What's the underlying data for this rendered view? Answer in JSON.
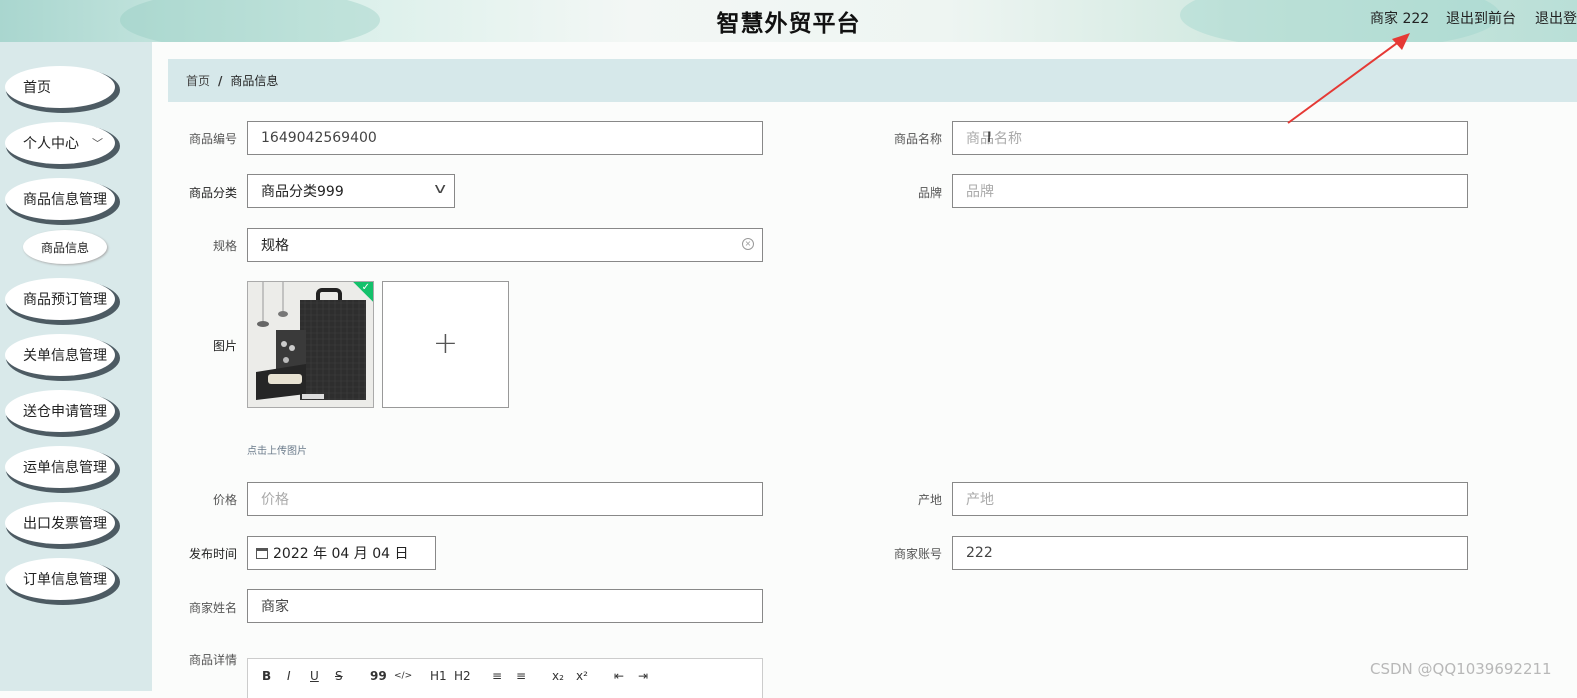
{
  "header": {
    "title": "智慧外贸平台",
    "user": "商家 222",
    "links": [
      "退出到前台",
      "退出登录"
    ]
  },
  "sidebar": {
    "items": [
      {
        "label": "首页"
      },
      {
        "label": "个人中心",
        "has_arrow": true
      },
      {
        "label": "商品信息管理"
      },
      {
        "label": "商品预订管理"
      },
      {
        "label": "关单信息管理"
      },
      {
        "label": "送仓申请管理"
      },
      {
        "label": "运单信息管理"
      },
      {
        "label": "出口发票管理"
      },
      {
        "label": "订单信息管理"
      }
    ],
    "sub_item": "商品信息"
  },
  "breadcrumb": {
    "home": "首页",
    "separator": "/",
    "current": "商品信息"
  },
  "form": {
    "product_no": {
      "label": "商品编号",
      "value": "1649042569400"
    },
    "product_name": {
      "label": "商品名称",
      "placeholder": "商品名称"
    },
    "category": {
      "label": "商品分类",
      "value": "商品分类999"
    },
    "brand": {
      "label": "品牌",
      "placeholder": "品牌"
    },
    "spec": {
      "label": "规格",
      "value": "规格"
    },
    "image": {
      "label": "图片",
      "tip": "点击上传图片",
      "add_symbol": "+"
    },
    "price": {
      "label": "价格",
      "placeholder": "价格"
    },
    "origin": {
      "label": "产地",
      "placeholder": "产地"
    },
    "publish_time": {
      "label": "发布时间",
      "value": "2022 年 04 月 04 日"
    },
    "merchant_account": {
      "label": "商家账号",
      "value": "222"
    },
    "merchant_name": {
      "label": "商家姓名",
      "value": "商家"
    },
    "details": {
      "label": "商品详情"
    }
  },
  "editor_toolbar": [
    "B",
    "I",
    "U",
    "S",
    "99",
    "</>",
    "H1",
    "H2",
    "≡",
    "≡",
    "x₂",
    "x²",
    "⇤",
    "⇥"
  ],
  "watermark": "CSDN @QQ1039692211",
  "colors": {
    "sidebar_bg": "#d9e9ea",
    "breadcrumb_bg": "#d6e8ea",
    "nav_shadow": "#4d5b63",
    "check_badge": "#13c16b"
  }
}
